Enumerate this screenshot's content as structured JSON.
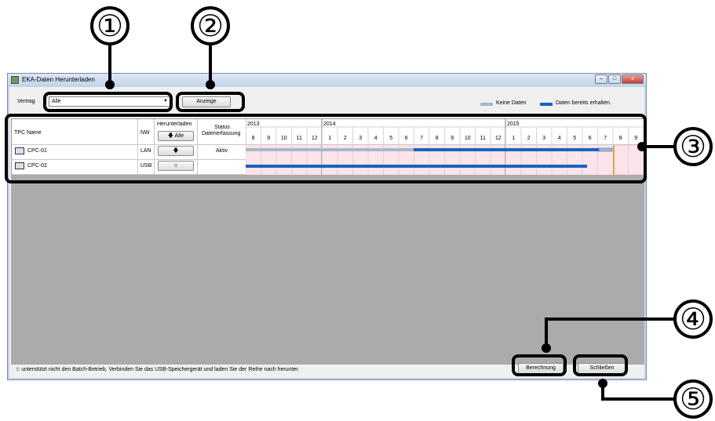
{
  "callouts": [
    "①",
    "②",
    "③",
    "④",
    "⑤"
  ],
  "window": {
    "title": "EKA-Daten Herunterladen",
    "controls": {
      "minimize": "–",
      "maximize": "□",
      "close": "x"
    }
  },
  "toolbar": {
    "contract_label": "Vertrag",
    "contract_value": "Alle",
    "display_button": "Anzeige"
  },
  "legend": {
    "no_data": "Keine Daten",
    "received": "Daten bereits erhalten.",
    "colors": {
      "no_data": "#aab8c8",
      "received": "#1565c0"
    }
  },
  "table": {
    "headers": {
      "tpc_name": "TPC Name",
      "nw": "NW",
      "download": "Herunterladen",
      "download_all": "Alle",
      "status_line1": "Status",
      "status_line2": "Datenerfassung"
    },
    "years": [
      "2013",
      "2014",
      "2015"
    ],
    "months": [
      "8",
      "9",
      "10",
      "11",
      "12",
      "1",
      "2",
      "3",
      "4",
      "5",
      "6",
      "7",
      "8",
      "9",
      "10",
      "11",
      "12",
      "1",
      "2",
      "3",
      "4",
      "5",
      "6",
      "7",
      "8",
      "9"
    ],
    "rows": [
      {
        "name": "CPC-01",
        "nw": "LAN",
        "status": "Aktiv",
        "download_icon": "download-arrow-icon"
      },
      {
        "name": "CPC-02",
        "nw": "USB",
        "status": "",
        "download_icon": "usb-icon"
      }
    ]
  },
  "footer": {
    "note": "unterstützt nicht den Batch-Betrieb. Verbinden Sie das USB-Speichergerät und laden Sie der Reihe nach herunter.",
    "calculate_button": "Berechnung",
    "close_button": "Schließen"
  }
}
